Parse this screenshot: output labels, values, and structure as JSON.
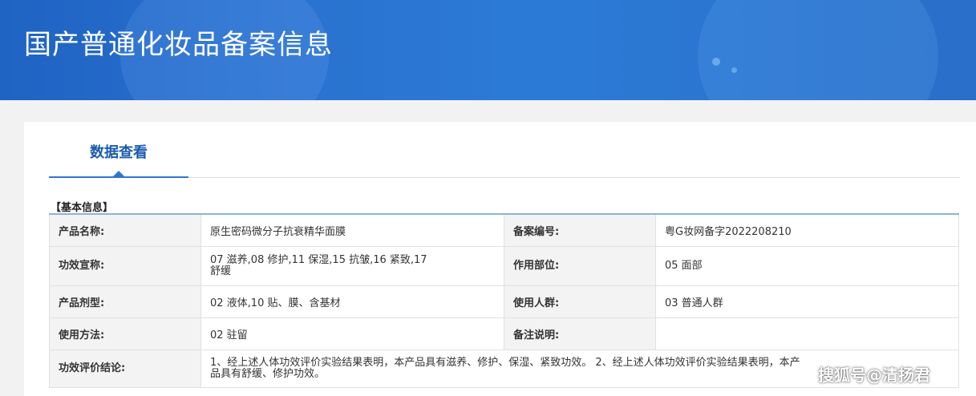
{
  "header": {
    "title": "国产普通化妆品备案信息"
  },
  "tabs": [
    {
      "label": "数据查看"
    }
  ],
  "section": {
    "title": "【基本信息】"
  },
  "table": {
    "rows": [
      {
        "label1": "产品名称:",
        "value1": "原生密码微分子抗衰精华面膜",
        "label2": "备案编号:",
        "value2": "粤G妆网备字2022208210"
      },
      {
        "label1": "功效宣称:",
        "value1": "07 滋养,08 修护,11 保湿,15 抗皱,16 紧致,17 舒缓",
        "label2": "作用部位:",
        "value2": "05 面部"
      },
      {
        "label1": "产品剂型:",
        "value1": "02 液体,10 贴、膜、含基材",
        "label2": "使用人群:",
        "value2": "03 普通人群"
      },
      {
        "label1": "使用方法:",
        "value1": "02 驻留",
        "label2": "备注说明:",
        "value2": ""
      },
      {
        "label1": "功效评价结论:",
        "value1": "1、经上述人体功效评价实验结果表明，本产品具有滋养、修护、保湿、紧致功效。 2、经上述人体功效评价实验结果表明，本产品具有舒缓、修护功效。"
      }
    ]
  },
  "watermark": {
    "text": "搜狐号@清扬君"
  }
}
